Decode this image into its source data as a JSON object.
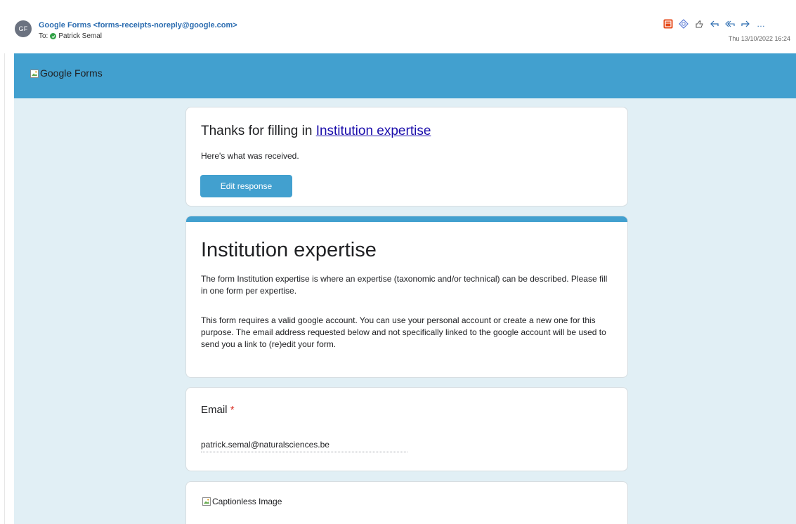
{
  "mail": {
    "avatar_initials": "GF",
    "sender": "Google Forms <forms-receipts-noreply@google.com>",
    "to_prefix": "To:",
    "recipient": "Patrick Semal",
    "date": "Thu 13/10/2022 16:24",
    "toolbar_icons": [
      "office-app-icon",
      "tag-icon",
      "like-icon",
      "reply-icon",
      "reply-all-icon",
      "forward-icon",
      "more-icon"
    ],
    "more_label": "…"
  },
  "banner": {
    "logo_alt": "Google Forms",
    "color": "#42a0cf"
  },
  "receipt": {
    "thanks_prefix": "Thanks for filling in ",
    "form_link": "Institution expertise",
    "received_text": "Here's what was received.",
    "edit_button": "Edit response"
  },
  "form": {
    "title": "Institution expertise",
    "description_1": "The form Institution expertise is where an expertise (taxonomic and/or technical) can be described. Please fill in one form per expertise.",
    "description_2": "This form requires a valid google account. You can use your personal account or create a new one for this purpose. The email address requested below and not specifically linked to the google account will be used to send you a link to (re)edit your form."
  },
  "email_question": {
    "label": "Email",
    "required_mark": "*",
    "answer": "patrick.semal@naturalsciences.be"
  },
  "image_question": {
    "alt": "Captionless Image"
  },
  "colors": {
    "accent": "#42a0cf",
    "background": "#e1eff5",
    "link": "#1a0dab",
    "required": "#d93025"
  }
}
